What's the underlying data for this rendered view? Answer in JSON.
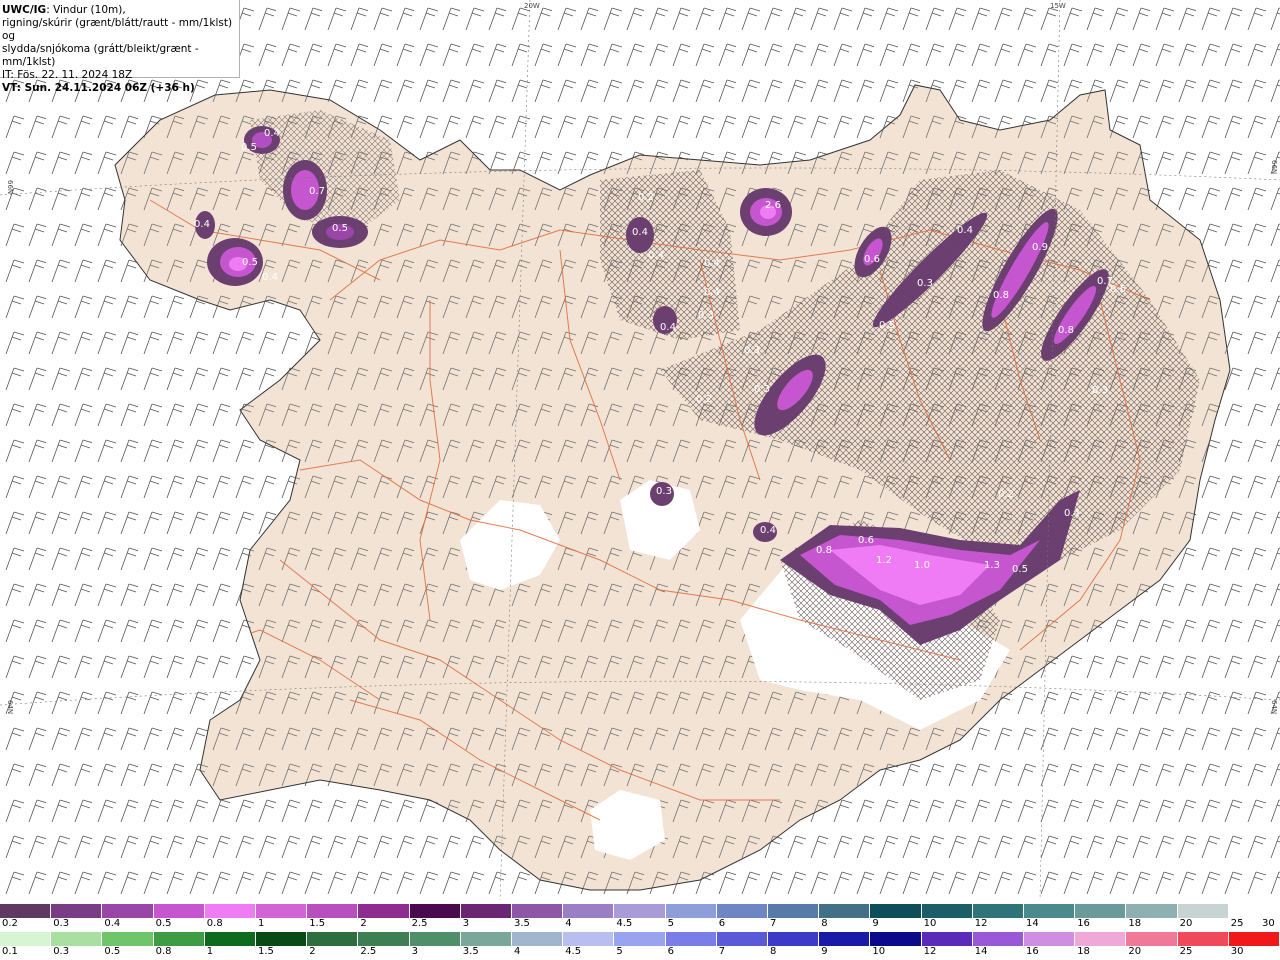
{
  "header": {
    "model": "UWC/IG",
    "line1_rest": ": Vindur (10m),",
    "line2": "rigning/skúrir (grænt/blátt/rautt - mm/1klst) og",
    "line3": "slydda/snjókoma (grátt/bleikt/grænt - mm/1klst)",
    "line4": "IT: Fös. 22. 11. 2024 18Z",
    "line5": "VT: Sun. 24.11.2024 06Z (+36 h)"
  },
  "coords": {
    "lon_top_1": "20W",
    "lon_top_2": "15W",
    "lat_left_1": "66N",
    "lat_left_2": "64N",
    "lat_right_1": "66N",
    "lat_right_2": "64N"
  },
  "labels": [
    "0.4",
    "0.5",
    "0.7",
    "0.5",
    "0.4",
    "0.5",
    "0.4",
    "0.2",
    "0.4",
    "0.4",
    "0.4",
    "0.4",
    "0.3",
    "0.4",
    "2.6",
    "0.6",
    "0.4",
    "0.3",
    "0.9",
    "0.8",
    "0.5",
    "0.8",
    "0.7",
    "0.6",
    "0.3",
    "0.3",
    "0.3",
    "0.4",
    "0.8",
    "0.6",
    "1.2",
    "1.0",
    "1.3",
    "0.5",
    "0.2",
    "0.4",
    "0.3",
    "0.2"
  ],
  "legend": {
    "snow_colors": [
      "#5e3a62",
      "#7b3c86",
      "#9a46a8",
      "#c556cf",
      "#f07cf5",
      "#d265d6",
      "#b94fbf",
      "#8e2c8f",
      "#4a0a4f",
      "#6b2673",
      "#8d57a6",
      "#9a7fc5",
      "#a99ad8",
      "#8e9ed8",
      "#6f86c4",
      "#587aa8",
      "#417088",
      "#0e4d5a",
      "#1c5e68",
      "#2e7478",
      "#4a8a8c",
      "#6a9a9a",
      "#8fb0b0",
      "#c8d4d4",
      ""
    ],
    "snow_ticks": [
      "0.2",
      "0.3",
      "0.4",
      "0.5",
      "0.8",
      "1",
      "1.5",
      "2",
      "2.5",
      "3",
      "3.5",
      "4",
      "4.5",
      "5",
      "6",
      "7",
      "8",
      "9",
      "10",
      "12",
      "14",
      "16",
      "18",
      "20",
      "25",
      "30"
    ],
    "rain_colors": [
      "#d6f5d2",
      "#a9e0a2",
      "#6fc56a",
      "#3e9c45",
      "#0e6a1c",
      "#0a4a16",
      "#2e6e3e",
      "#3d7f52",
      "#4f8f6a",
      "#7aa79a",
      "#a0b6cc",
      "#b8bff0",
      "#9aa4ee",
      "#7a7de8",
      "#5a5ad8",
      "#3b3bc8",
      "#1a1aa8",
      "#0a0a8a",
      "#5a2ab8",
      "#9a58d6",
      "#d08ee0",
      "#f0a8d8",
      "#f07898",
      "#f04a5a",
      "#f01818"
    ],
    "rain_ticks": [
      "0.1",
      "0.3",
      "0.5",
      "0.8",
      "1",
      "1.5",
      "2",
      "2.5",
      "3",
      "3.5",
      "4",
      "4.5",
      "5",
      "6",
      "7",
      "8",
      "9",
      "10",
      "12",
      "14",
      "16",
      "18",
      "20",
      "25",
      "30"
    ]
  }
}
